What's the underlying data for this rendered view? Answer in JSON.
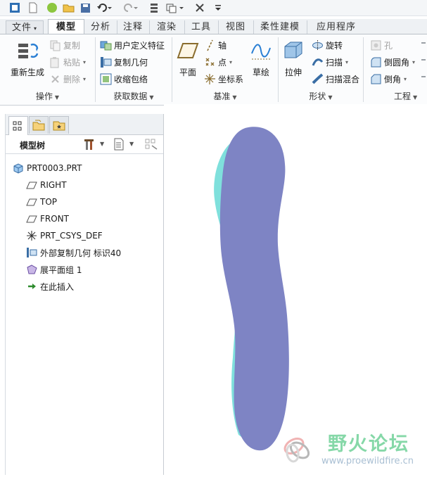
{
  "ribbon_tabs": [
    {
      "label": "文件",
      "file": true
    },
    {
      "label": "模型",
      "active": true
    },
    {
      "label": "分析"
    },
    {
      "label": "注释"
    },
    {
      "label": "渲染"
    },
    {
      "label": "工具"
    },
    {
      "label": "视图"
    },
    {
      "label": "柔性建模"
    },
    {
      "label": "应用程序"
    }
  ],
  "groups": {
    "operations": {
      "label": "操作",
      "regenerate": "重新生成",
      "copy": "复制",
      "paste": "粘贴",
      "delete": "删除"
    },
    "get_data": {
      "label": "获取数据",
      "user_defined_feature": "用户定义特征",
      "copy_geometry": "复制几何",
      "shrinkwrap": "收缩包络"
    },
    "datum": {
      "label": "基准",
      "plane": "平面",
      "axis": "轴",
      "point": "点",
      "csys": "坐标系",
      "sketch": "草绘"
    },
    "shapes": {
      "label": "形状",
      "extrude": "拉伸",
      "revolve": "旋转",
      "sweep": "扫描",
      "swept_blend": "扫描混合"
    },
    "engineering": {
      "label": "工程",
      "hole": "孔",
      "round": "倒圆角",
      "chamfer": "倒角"
    }
  },
  "model_tree": {
    "title": "模型树",
    "items": [
      {
        "label": "PRT0003.PRT",
        "icon": "part-icon"
      },
      {
        "label": "RIGHT",
        "icon": "datum-plane-icon"
      },
      {
        "label": "TOP",
        "icon": "datum-plane-icon"
      },
      {
        "label": "FRONT",
        "icon": "datum-plane-icon"
      },
      {
        "label": "PRT_CSYS_DEF",
        "icon": "csys-icon"
      },
      {
        "label": "外部复制几何 标识40",
        "icon": "external-copy-geometry-icon"
      },
      {
        "label": "展平面组 1",
        "icon": "flatten-quilt-icon"
      },
      {
        "label": "在此插入",
        "icon": "insert-here-arrow-icon"
      }
    ]
  },
  "watermark": {
    "text": "野火论坛",
    "url": "www.proewildfire.cn"
  },
  "colors": {
    "model_face": "#7e84c4",
    "model_edge": "#7fe0dc",
    "watermark_text": "#86d8a8"
  }
}
